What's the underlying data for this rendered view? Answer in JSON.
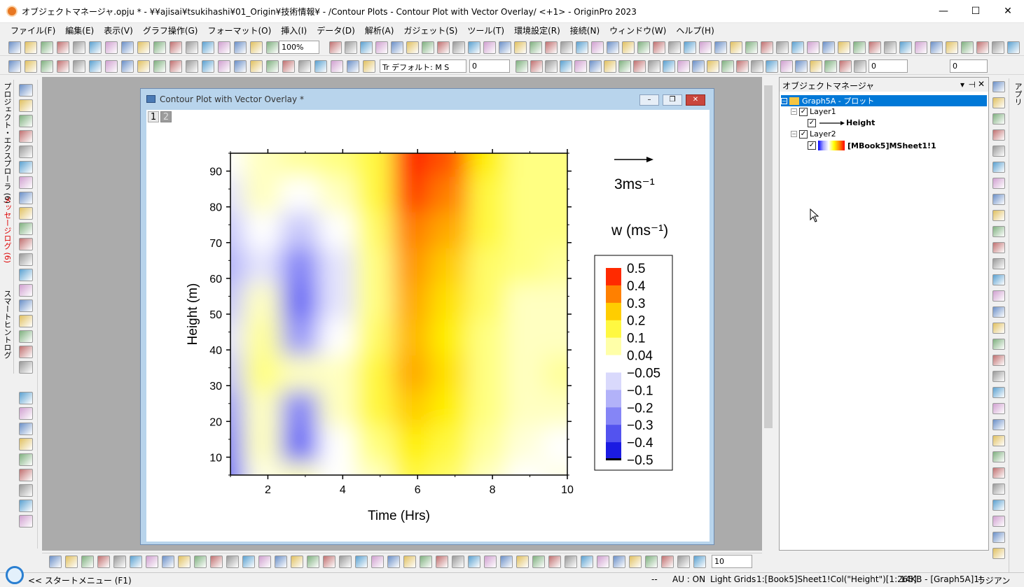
{
  "window": {
    "title": "オブジェクトマネージャ.opju * - ¥¥ajisai¥tsukihashi¥01_Origin¥技術情報¥ - /Contour Plots - Contour Plot with Vector Overlay/ <+1> - OriginPro 2023",
    "minimize": "—",
    "maximize": "☐",
    "close": "✕"
  },
  "menu": [
    "ファイル(F)",
    "編集(E)",
    "表示(V)",
    "グラフ操作(G)",
    "フォーマット(O)",
    "挿入(I)",
    "データ(D)",
    "解析(A)",
    "ガジェット(S)",
    "ツール(T)",
    "環境設定(R)",
    "接続(N)",
    "ウィンドウ(W)",
    "ヘルプ(H)"
  ],
  "toolbar": {
    "zoom": "100%",
    "font": "Tr デフォルト: M S",
    "font_size": "0",
    "line_width": "0",
    "color_width": "0",
    "bottom_size": "10"
  },
  "side_tabs": {
    "project_explorer": "プロジェクト・エクスプローラ (6)",
    "message_log": "メッセージログ (6)",
    "smart_hint": "スマートヒントログ"
  },
  "graph_window": {
    "title": "Contour Plot with Vector Overlay *",
    "layer_tab_1": "1",
    "layer_tab_2": "2"
  },
  "object_manager": {
    "title": "オブジェクトマネージャ",
    "root": "Graph5A - プロット",
    "layer1": "Layer1",
    "layer1_plot": "Height",
    "layer2": "Layer2",
    "layer2_plot": "[MBook5]MSheet1!1"
  },
  "apps_tab": "アプリ",
  "chart_data": {
    "type": "heatmap",
    "xlabel": "Time (Hrs)",
    "ylabel": "Height (m)",
    "xlim": [
      1,
      10
    ],
    "ylim": [
      5,
      95
    ],
    "xticks": [
      2,
      4,
      6,
      8,
      10
    ],
    "yticks": [
      10,
      20,
      30,
      40,
      50,
      60,
      70,
      80,
      90
    ],
    "colorbar_title": "w (ms⁻¹)",
    "colorbar_levels": [
      "0.5",
      "0.4",
      "0.3",
      "0.2",
      "0.1",
      "0.04",
      "−0.05",
      "−0.1",
      "−0.2",
      "−0.3",
      "−0.4",
      "−0.5"
    ],
    "vector_scale_label": "3ms⁻¹",
    "x": [
      1,
      2,
      3,
      4,
      5,
      6,
      7,
      8,
      9,
      10
    ],
    "y": [
      5,
      15,
      25,
      35,
      45,
      55,
      65,
      75,
      85,
      95
    ],
    "z": [
      [
        -0.3,
        0.02,
        0.05,
        0.0,
        0.05,
        0.15,
        0.12,
        0.05,
        0.0,
        0.02
      ],
      [
        -0.25,
        0.05,
        -0.3,
        0.0,
        0.1,
        0.2,
        0.15,
        0.08,
        0.03,
        0.0
      ],
      [
        -0.2,
        0.05,
        -0.25,
        0.05,
        0.15,
        0.25,
        0.2,
        0.1,
        0.05,
        0.05
      ],
      [
        -0.1,
        0.1,
        0.05,
        0.05,
        0.15,
        0.3,
        0.22,
        0.1,
        0.05,
        0.08
      ],
      [
        -0.05,
        0.08,
        -0.2,
        0.0,
        0.12,
        0.28,
        0.2,
        0.1,
        0.05,
        0.05
      ],
      [
        -0.1,
        0.05,
        -0.3,
        -0.05,
        0.1,
        0.3,
        0.22,
        0.12,
        0.05,
        0.05
      ],
      [
        -0.15,
        -0.05,
        -0.25,
        -0.05,
        0.1,
        0.32,
        0.25,
        0.12,
        0.1,
        0.08
      ],
      [
        -0.1,
        0.0,
        -0.1,
        0.0,
        0.12,
        0.35,
        0.3,
        0.15,
        0.1,
        0.1
      ],
      [
        -0.05,
        0.05,
        0.0,
        0.05,
        0.15,
        0.42,
        0.35,
        0.15,
        0.1,
        0.1
      ],
      [
        0.0,
        0.05,
        0.08,
        0.1,
        0.15,
        0.45,
        0.4,
        0.2,
        0.1,
        0.1
      ]
    ]
  },
  "status": {
    "start_menu": "<< スタートメニュー (F1)",
    "dash": "--",
    "au": "AU : ON",
    "grids": "Light Grids",
    "cell": "1:[Book5]Sheet1!Col(\"Height\")[1:265]",
    "info": "14KB - [Graph5A]1!",
    "unit": "ラジアン"
  }
}
